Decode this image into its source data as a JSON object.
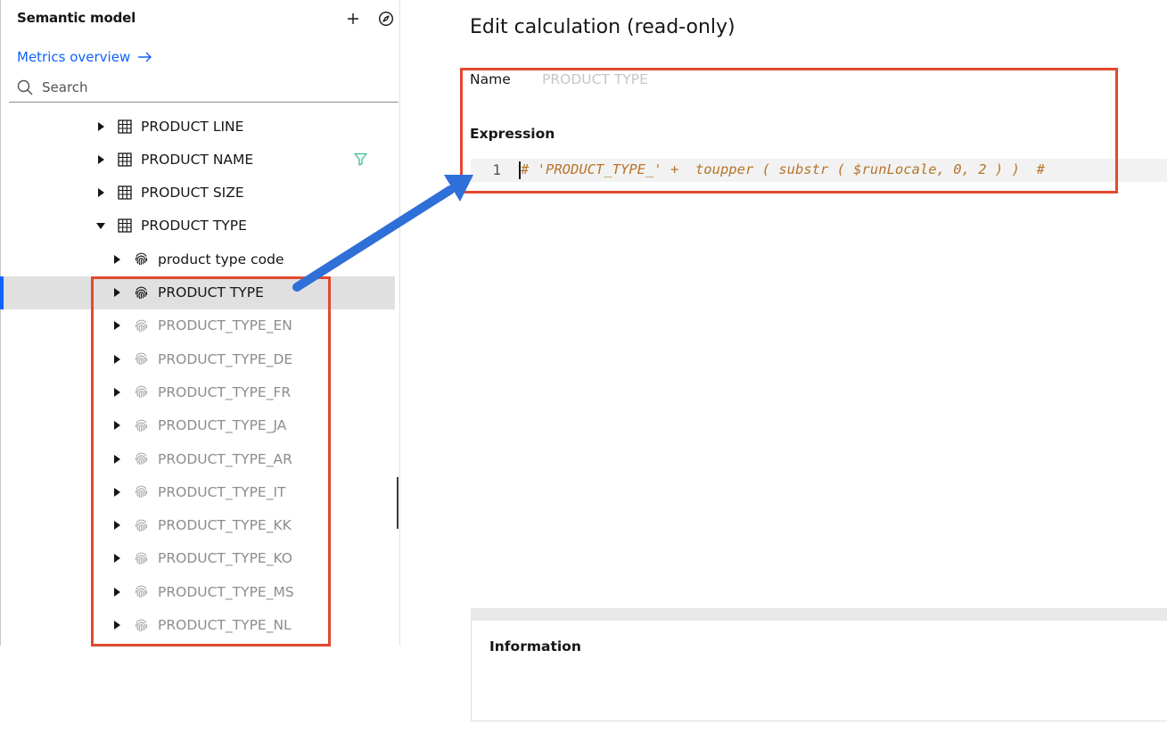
{
  "sidebar": {
    "title": "Semantic model",
    "add_icon": "plus-icon",
    "compass_icon": "compass-icon",
    "metrics_link": "Metrics overview",
    "search_placeholder": "Search",
    "tree": [
      {
        "label": "PRODUCT LINE",
        "type": "table",
        "level": 1,
        "expanded": false,
        "dim": false,
        "filter": false,
        "selected": false
      },
      {
        "label": "PRODUCT NAME",
        "type": "table",
        "level": 1,
        "expanded": false,
        "dim": false,
        "filter": true,
        "selected": false
      },
      {
        "label": "PRODUCT SIZE",
        "type": "table",
        "level": 1,
        "expanded": false,
        "dim": false,
        "filter": false,
        "selected": false
      },
      {
        "label": "PRODUCT TYPE",
        "type": "table",
        "level": 1,
        "expanded": true,
        "dim": false,
        "filter": false,
        "selected": false
      },
      {
        "label": "product type code",
        "type": "fingerprint",
        "level": 2,
        "expanded": false,
        "dim": false,
        "filter": false,
        "selected": false
      },
      {
        "label": "PRODUCT TYPE",
        "type": "fingerprint",
        "level": 2,
        "expanded": false,
        "dim": false,
        "filter": false,
        "selected": true
      },
      {
        "label": "PRODUCT_TYPE_EN",
        "type": "fingerprint",
        "level": 2,
        "expanded": false,
        "dim": true,
        "filter": false,
        "selected": false
      },
      {
        "label": "PRODUCT_TYPE_DE",
        "type": "fingerprint",
        "level": 2,
        "expanded": false,
        "dim": true,
        "filter": false,
        "selected": false
      },
      {
        "label": "PRODUCT_TYPE_FR",
        "type": "fingerprint",
        "level": 2,
        "expanded": false,
        "dim": true,
        "filter": false,
        "selected": false
      },
      {
        "label": "PRODUCT_TYPE_JA",
        "type": "fingerprint",
        "level": 2,
        "expanded": false,
        "dim": true,
        "filter": false,
        "selected": false
      },
      {
        "label": "PRODUCT_TYPE_AR",
        "type": "fingerprint",
        "level": 2,
        "expanded": false,
        "dim": true,
        "filter": false,
        "selected": false
      },
      {
        "label": "PRODUCT_TYPE_IT",
        "type": "fingerprint",
        "level": 2,
        "expanded": false,
        "dim": true,
        "filter": false,
        "selected": false
      },
      {
        "label": "PRODUCT_TYPE_KK",
        "type": "fingerprint",
        "level": 2,
        "expanded": false,
        "dim": true,
        "filter": false,
        "selected": false
      },
      {
        "label": "PRODUCT_TYPE_KO",
        "type": "fingerprint",
        "level": 2,
        "expanded": false,
        "dim": true,
        "filter": false,
        "selected": false
      },
      {
        "label": "PRODUCT_TYPE_MS",
        "type": "fingerprint",
        "level": 2,
        "expanded": false,
        "dim": true,
        "filter": false,
        "selected": false
      },
      {
        "label": "PRODUCT_TYPE_NL",
        "type": "fingerprint",
        "level": 2,
        "expanded": false,
        "dim": true,
        "filter": false,
        "selected": false
      }
    ]
  },
  "editor": {
    "title": "Edit calculation (read-only)",
    "name_label": "Name",
    "name_value": "PRODUCT TYPE",
    "expression_label": "Expression",
    "line_number": "1",
    "expression": "# 'PRODUCT_TYPE_' +  toupper ( substr ( $runLocale, 0, 2 ) )  #",
    "information_label": "Information"
  },
  "colors": {
    "link": "#0f62fe",
    "selection_bar": "#0f62fe",
    "annotation_box": "#e2492f",
    "annotation_arrow": "#2f6fd8",
    "code_text": "#b7752b"
  }
}
